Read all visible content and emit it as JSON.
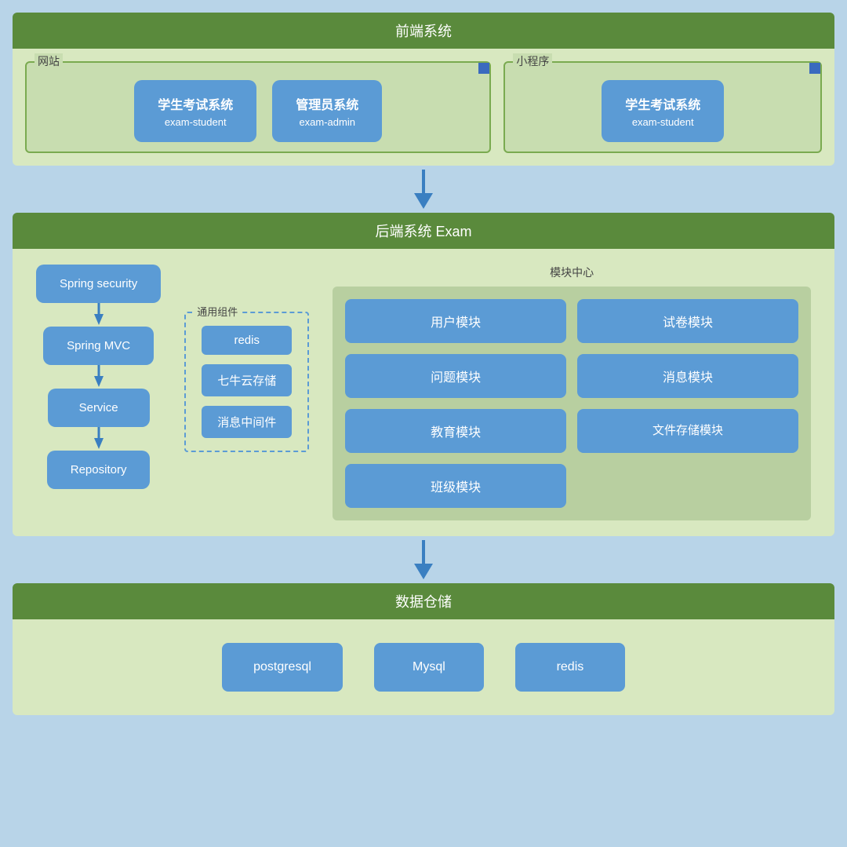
{
  "frontend": {
    "title": "前端系统",
    "website": {
      "label": "网站",
      "apps": [
        {
          "name": "学生考试系统",
          "sub": "exam-student"
        },
        {
          "name": "管理员系统",
          "sub": "exam-admin"
        }
      ]
    },
    "miniprogram": {
      "label": "小程序",
      "apps": [
        {
          "name": "学生考试系统",
          "sub": "exam-student"
        }
      ]
    }
  },
  "backend": {
    "title": "后端系统 Exam",
    "stack": [
      {
        "label": "Spring security"
      },
      {
        "label": "Spring MVC"
      },
      {
        "label": "Service"
      },
      {
        "label": "Repository"
      }
    ],
    "common": {
      "label": "通用组件",
      "items": [
        "redis",
        "七牛云存储",
        "消息中间件"
      ]
    },
    "modules": {
      "label": "模块中心",
      "items": [
        {
          "name": "用户模块"
        },
        {
          "name": "试卷模块"
        },
        {
          "name": "问题模块"
        },
        {
          "name": "消息模块"
        },
        {
          "name": "教育模块"
        },
        {
          "name": "文件存储模块"
        },
        {
          "name": "班级模块"
        }
      ]
    }
  },
  "data_warehouse": {
    "title": "数据仓储",
    "dbs": [
      "postgresql",
      "Mysql",
      "redis"
    ]
  },
  "colors": {
    "green_header": "#5a8a3c",
    "green_body": "#d8e8c0",
    "blue_box": "#5b9bd5",
    "arrow_blue": "#3a7fc1",
    "corner_blue": "#3a6abf"
  }
}
